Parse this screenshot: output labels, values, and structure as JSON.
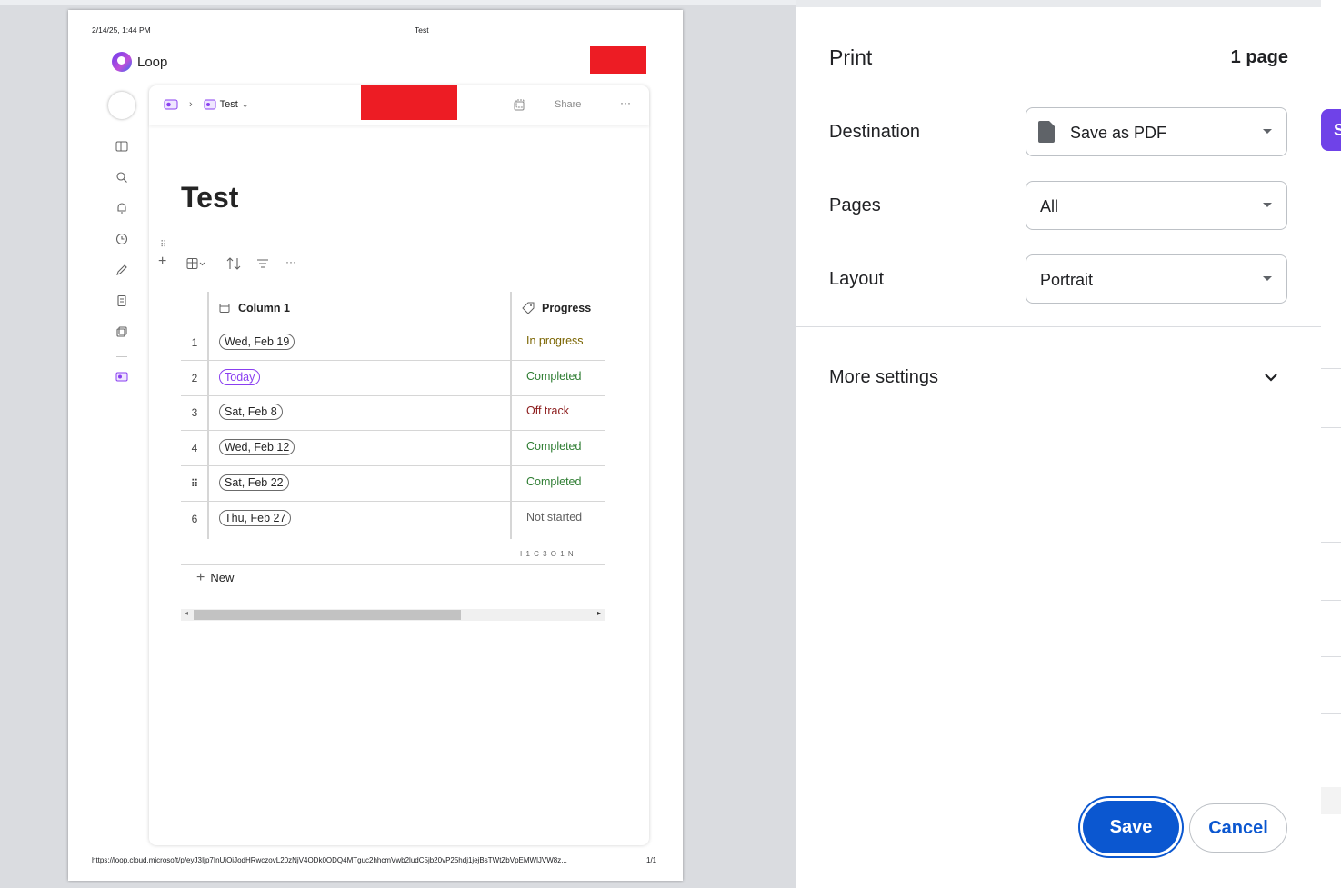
{
  "preview": {
    "header_date": "2/14/25, 1:44 PM",
    "header_title": "Test",
    "footer_url": "https://loop.cloud.microsoft/p/eyJ3Ijp7InUiOiJodHRwczovL20zNjV4ODk0ODQ4MTguc2hhcmVwb2ludC5jb20vP25hdj1jejBsTWtZbVpEMWlJVW8z...",
    "footer_page": "1/1",
    "app_name": "Loop",
    "breadcrumb_page": "Test",
    "share_label": "Share",
    "more_label": "···",
    "doc_title": "Test",
    "table": {
      "columns": [
        "Column 1",
        "Progress"
      ],
      "rows": [
        {
          "num": "1",
          "date": "Wed, Feb 19",
          "progress": "In progress",
          "color": "#7a6400"
        },
        {
          "num": "2",
          "date": "Today",
          "progress": "Completed",
          "color": "#2e7d32"
        },
        {
          "num": "3",
          "date": "Sat, Feb 8",
          "progress": "Off track",
          "color": "#8b1a1a"
        },
        {
          "num": "4",
          "date": "Wed, Feb 12",
          "progress": "Completed",
          "color": "#2e7d32"
        },
        {
          "num": "",
          "date": "Sat, Feb 22",
          "progress": "Completed",
          "color": "#2e7d32"
        },
        {
          "num": "6",
          "date": "Thu, Feb 27",
          "progress": "Not started",
          "color": "#5f5f5f"
        }
      ],
      "summary": "I 1  C 3  O 1  N",
      "new_label": "New"
    }
  },
  "print_panel": {
    "title": "Print",
    "page_count": "1 page",
    "destination_label": "Destination",
    "destination_value": "Save as PDF",
    "pages_label": "Pages",
    "pages_value": "All",
    "layout_label": "Layout",
    "layout_value": "Portrait",
    "more_settings_label": "More settings",
    "save_label": "Save",
    "cancel_label": "Cancel",
    "edge_tab_letter": "S"
  }
}
